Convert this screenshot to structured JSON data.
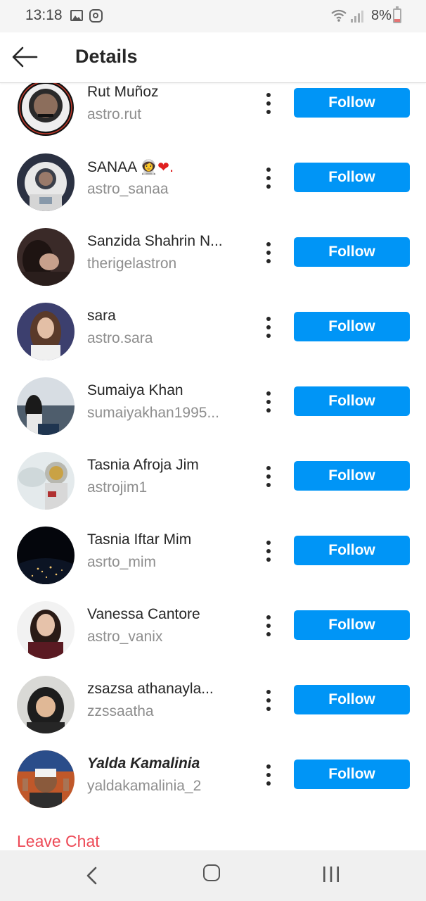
{
  "status_bar": {
    "time": "13:18",
    "battery": "8%",
    "icons": [
      "gallery-icon",
      "instagram-icon",
      "wifi-icon",
      "signal-icon",
      "battery-icon"
    ]
  },
  "header": {
    "title": "Details",
    "back_icon": "arrow-left-icon"
  },
  "members": [
    {
      "name": "Rut Muñoz",
      "username": "astro.rut",
      "action": "Follow"
    },
    {
      "name": "SANAA 👩🏻‍🚀❤️.",
      "name_text": "SANAA",
      "name_suffix": "👩‍🚀❤.",
      "username": "astro_sanaa",
      "action": "Follow"
    },
    {
      "name": "Sanzida Shahrin N...",
      "username": "therigelastron",
      "action": "Follow"
    },
    {
      "name": "sara",
      "username": "astro.sara",
      "action": "Follow"
    },
    {
      "name": "Sumaiya Khan",
      "username": "sumaiyakhan1995...",
      "action": "Follow"
    },
    {
      "name": "Tasnia Afroja Jim",
      "username": "astrojim1",
      "action": "Follow"
    },
    {
      "name": "Tasnia Iftar Mim",
      "username": "asrto_mim",
      "action": "Follow"
    },
    {
      "name": "Vanessa Cantore",
      "username": "astro_vanix",
      "action": "Follow"
    },
    {
      "name": "zsazsa athanayla...",
      "username": "zzssaatha",
      "action": "Follow"
    },
    {
      "name": "Yalda Kamalinia",
      "username": "yaldakamalinia_2",
      "action": "Follow"
    }
  ],
  "leave_chat": "Leave Chat",
  "colors": {
    "follow_button": "#0095f6",
    "leave_chat": "#ed4956",
    "username": "#8e8e8e"
  },
  "nav_bar": {
    "icons": [
      "nav-back-icon",
      "nav-home-icon",
      "nav-recent-apps-icon"
    ]
  }
}
